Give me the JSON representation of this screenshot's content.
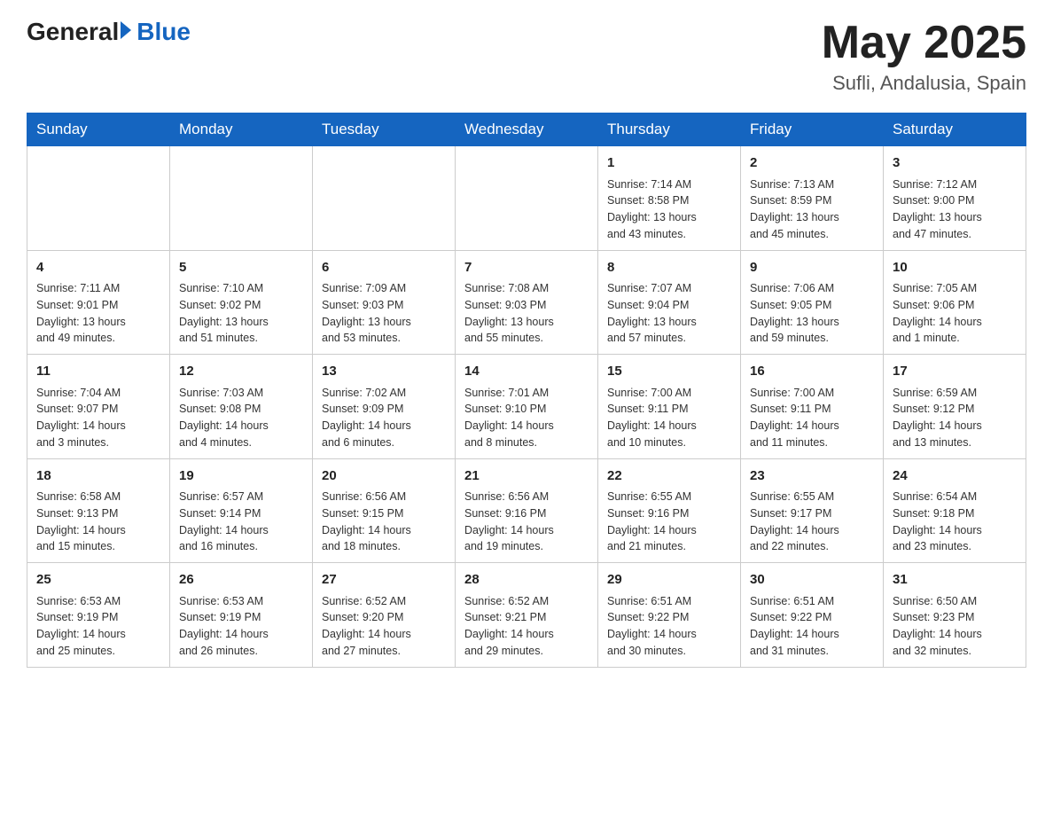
{
  "header": {
    "logo": {
      "general": "General",
      "blue": "Blue"
    },
    "title": "May 2025",
    "location": "Sufli, Andalusia, Spain"
  },
  "weekdays": [
    "Sunday",
    "Monday",
    "Tuesday",
    "Wednesday",
    "Thursday",
    "Friday",
    "Saturday"
  ],
  "weeks": [
    [
      {
        "day": "",
        "info": ""
      },
      {
        "day": "",
        "info": ""
      },
      {
        "day": "",
        "info": ""
      },
      {
        "day": "",
        "info": ""
      },
      {
        "day": "1",
        "info": "Sunrise: 7:14 AM\nSunset: 8:58 PM\nDaylight: 13 hours\nand 43 minutes."
      },
      {
        "day": "2",
        "info": "Sunrise: 7:13 AM\nSunset: 8:59 PM\nDaylight: 13 hours\nand 45 minutes."
      },
      {
        "day": "3",
        "info": "Sunrise: 7:12 AM\nSunset: 9:00 PM\nDaylight: 13 hours\nand 47 minutes."
      }
    ],
    [
      {
        "day": "4",
        "info": "Sunrise: 7:11 AM\nSunset: 9:01 PM\nDaylight: 13 hours\nand 49 minutes."
      },
      {
        "day": "5",
        "info": "Sunrise: 7:10 AM\nSunset: 9:02 PM\nDaylight: 13 hours\nand 51 minutes."
      },
      {
        "day": "6",
        "info": "Sunrise: 7:09 AM\nSunset: 9:03 PM\nDaylight: 13 hours\nand 53 minutes."
      },
      {
        "day": "7",
        "info": "Sunrise: 7:08 AM\nSunset: 9:03 PM\nDaylight: 13 hours\nand 55 minutes."
      },
      {
        "day": "8",
        "info": "Sunrise: 7:07 AM\nSunset: 9:04 PM\nDaylight: 13 hours\nand 57 minutes."
      },
      {
        "day": "9",
        "info": "Sunrise: 7:06 AM\nSunset: 9:05 PM\nDaylight: 13 hours\nand 59 minutes."
      },
      {
        "day": "10",
        "info": "Sunrise: 7:05 AM\nSunset: 9:06 PM\nDaylight: 14 hours\nand 1 minute."
      }
    ],
    [
      {
        "day": "11",
        "info": "Sunrise: 7:04 AM\nSunset: 9:07 PM\nDaylight: 14 hours\nand 3 minutes."
      },
      {
        "day": "12",
        "info": "Sunrise: 7:03 AM\nSunset: 9:08 PM\nDaylight: 14 hours\nand 4 minutes."
      },
      {
        "day": "13",
        "info": "Sunrise: 7:02 AM\nSunset: 9:09 PM\nDaylight: 14 hours\nand 6 minutes."
      },
      {
        "day": "14",
        "info": "Sunrise: 7:01 AM\nSunset: 9:10 PM\nDaylight: 14 hours\nand 8 minutes."
      },
      {
        "day": "15",
        "info": "Sunrise: 7:00 AM\nSunset: 9:11 PM\nDaylight: 14 hours\nand 10 minutes."
      },
      {
        "day": "16",
        "info": "Sunrise: 7:00 AM\nSunset: 9:11 PM\nDaylight: 14 hours\nand 11 minutes."
      },
      {
        "day": "17",
        "info": "Sunrise: 6:59 AM\nSunset: 9:12 PM\nDaylight: 14 hours\nand 13 minutes."
      }
    ],
    [
      {
        "day": "18",
        "info": "Sunrise: 6:58 AM\nSunset: 9:13 PM\nDaylight: 14 hours\nand 15 minutes."
      },
      {
        "day": "19",
        "info": "Sunrise: 6:57 AM\nSunset: 9:14 PM\nDaylight: 14 hours\nand 16 minutes."
      },
      {
        "day": "20",
        "info": "Sunrise: 6:56 AM\nSunset: 9:15 PM\nDaylight: 14 hours\nand 18 minutes."
      },
      {
        "day": "21",
        "info": "Sunrise: 6:56 AM\nSunset: 9:16 PM\nDaylight: 14 hours\nand 19 minutes."
      },
      {
        "day": "22",
        "info": "Sunrise: 6:55 AM\nSunset: 9:16 PM\nDaylight: 14 hours\nand 21 minutes."
      },
      {
        "day": "23",
        "info": "Sunrise: 6:55 AM\nSunset: 9:17 PM\nDaylight: 14 hours\nand 22 minutes."
      },
      {
        "day": "24",
        "info": "Sunrise: 6:54 AM\nSunset: 9:18 PM\nDaylight: 14 hours\nand 23 minutes."
      }
    ],
    [
      {
        "day": "25",
        "info": "Sunrise: 6:53 AM\nSunset: 9:19 PM\nDaylight: 14 hours\nand 25 minutes."
      },
      {
        "day": "26",
        "info": "Sunrise: 6:53 AM\nSunset: 9:19 PM\nDaylight: 14 hours\nand 26 minutes."
      },
      {
        "day": "27",
        "info": "Sunrise: 6:52 AM\nSunset: 9:20 PM\nDaylight: 14 hours\nand 27 minutes."
      },
      {
        "day": "28",
        "info": "Sunrise: 6:52 AM\nSunset: 9:21 PM\nDaylight: 14 hours\nand 29 minutes."
      },
      {
        "day": "29",
        "info": "Sunrise: 6:51 AM\nSunset: 9:22 PM\nDaylight: 14 hours\nand 30 minutes."
      },
      {
        "day": "30",
        "info": "Sunrise: 6:51 AM\nSunset: 9:22 PM\nDaylight: 14 hours\nand 31 minutes."
      },
      {
        "day": "31",
        "info": "Sunrise: 6:50 AM\nSunset: 9:23 PM\nDaylight: 14 hours\nand 32 minutes."
      }
    ]
  ]
}
